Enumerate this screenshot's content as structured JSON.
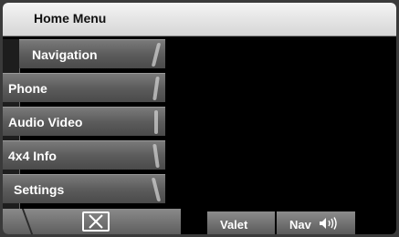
{
  "header": {
    "title": "Home Menu"
  },
  "menu": {
    "items": [
      {
        "label": "Navigation"
      },
      {
        "label": "Phone"
      },
      {
        "label": "Audio Video"
      },
      {
        "label": "4x4 Info"
      },
      {
        "label": "Settings"
      }
    ]
  },
  "footer": {
    "close_icon": "close-icon",
    "valet_label": "Valet",
    "nav_label": "Nav",
    "nav_icon": "speaker-icon"
  }
}
